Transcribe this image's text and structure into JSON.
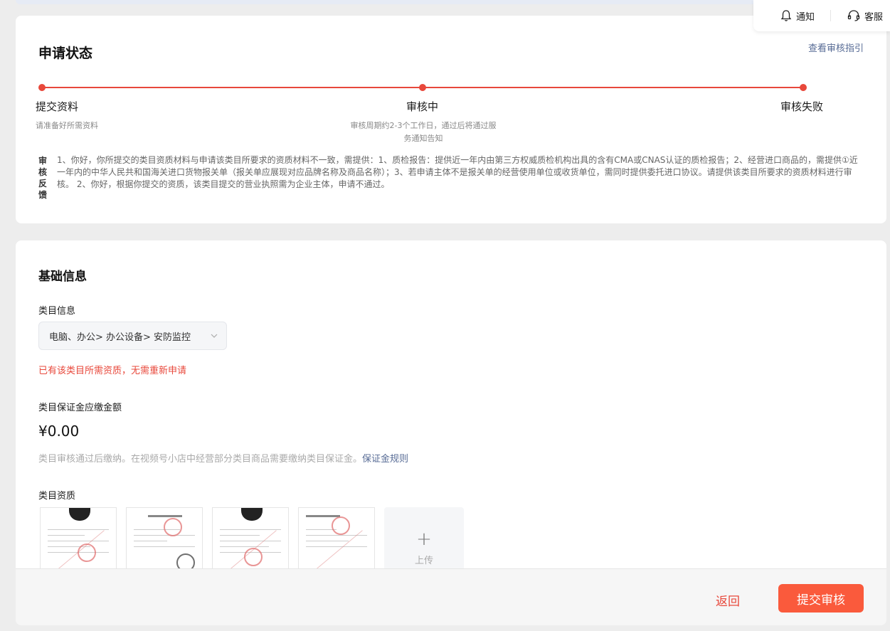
{
  "topbar": {
    "notify_label": "通知",
    "service_label": "客服"
  },
  "status": {
    "title": "申请状态",
    "guide_link": "查看审核指引",
    "steps": [
      {
        "title": "提交资料",
        "desc": "请准备好所需资料"
      },
      {
        "title": "审核中",
        "desc": "审核周期约2-3个工作日，通过后将通过服务通知告知"
      },
      {
        "title": "审核失败",
        "desc": ""
      }
    ],
    "feedback_label": "审核反馈",
    "feedback_text": "1、你好，你所提交的类目资质材料与申请该类目所要求的资质材料不一致，需提供：1、质检报告：提供近一年内由第三方权威质检机构出具的含有CMA或CNAS认证的质检报告；2、经营进口商品的，需提供①近一年内的中华人民共和国海关进口货物报关单（报关单应展现对应品牌名称及商品名称）；3、若申请主体不是报关单的经营使用单位或收货单位，需同时提供委托进口协议。请提供该类目所要求的资质材料进行审核。 2、你好，根据你提交的资质，该类目提交的营业执照需为企业主体，申请不通过。",
    "accent_color": "#e8483b"
  },
  "basic": {
    "title": "基础信息",
    "category_label": "类目信息",
    "category_value": "电脑、办公> 办公设备> 安防监控",
    "error_text": "已有该类目所需资质，无需重新申请",
    "deposit_label": "类目保证金应缴金额",
    "deposit_amount": "¥0.00",
    "deposit_hint": "类目审核通过后缴纳。在视频号小店中经营部分类目商品需要缴纳类目保证金。",
    "deposit_rule_link": "保证金规则",
    "qualification_label": "类目资质",
    "upload_label": "上传"
  },
  "footer": {
    "back_label": "返回",
    "submit_label": "提交审核",
    "submit_color": "#fa5a3c"
  }
}
